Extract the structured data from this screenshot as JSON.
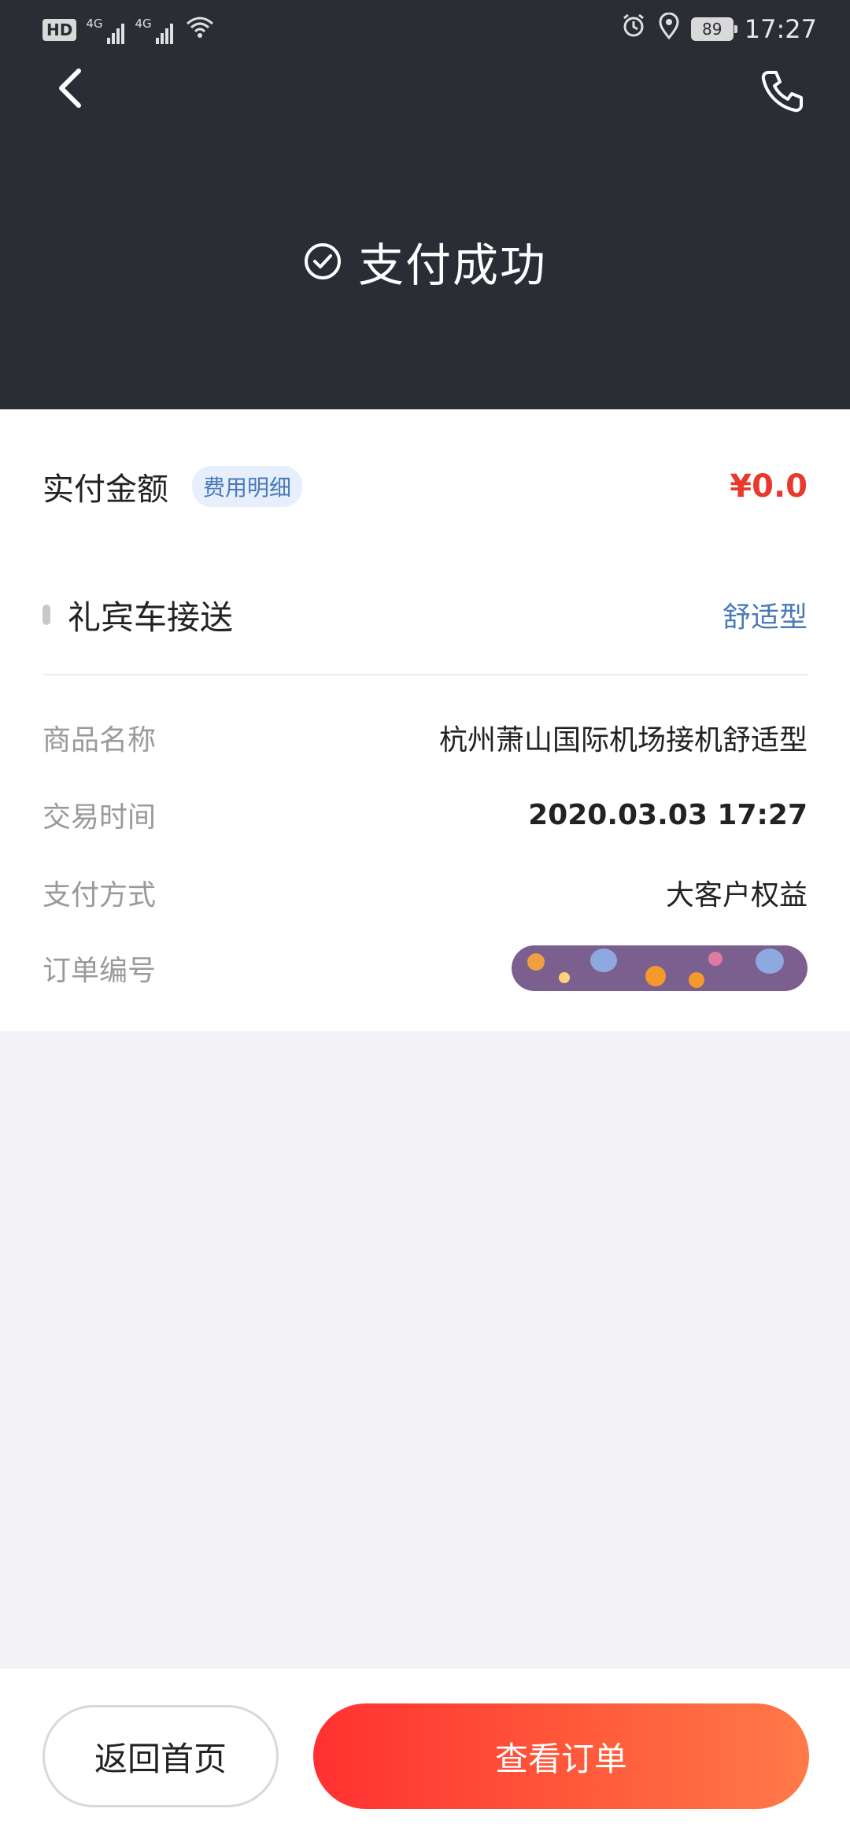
{
  "status_bar": {
    "hd": "HD",
    "network1": "4G",
    "network2": "4G",
    "battery": "89",
    "time": "17:27"
  },
  "header": {
    "title": "支付成功"
  },
  "payment": {
    "amount_label": "实付金额",
    "fee_detail_label": "费用明细",
    "amount_value": "¥0.0"
  },
  "service": {
    "name": "礼宾车接送",
    "type": "舒适型"
  },
  "details": [
    {
      "key": "商品名称",
      "value": "杭州萧山国际机场接机舒适型"
    },
    {
      "key": "交易时间",
      "value": "2020.03.03 17:27"
    },
    {
      "key": "支付方式",
      "value": "大客户权益"
    },
    {
      "key": "订单编号",
      "value": ""
    }
  ],
  "footer": {
    "home_label": "返回首页",
    "order_label": "查看订单"
  },
  "colors": {
    "header_bg": "#2b2d35",
    "accent_red": "#e8392c",
    "link_blue": "#4a7ab8",
    "page_bg": "#f3f3f7"
  }
}
